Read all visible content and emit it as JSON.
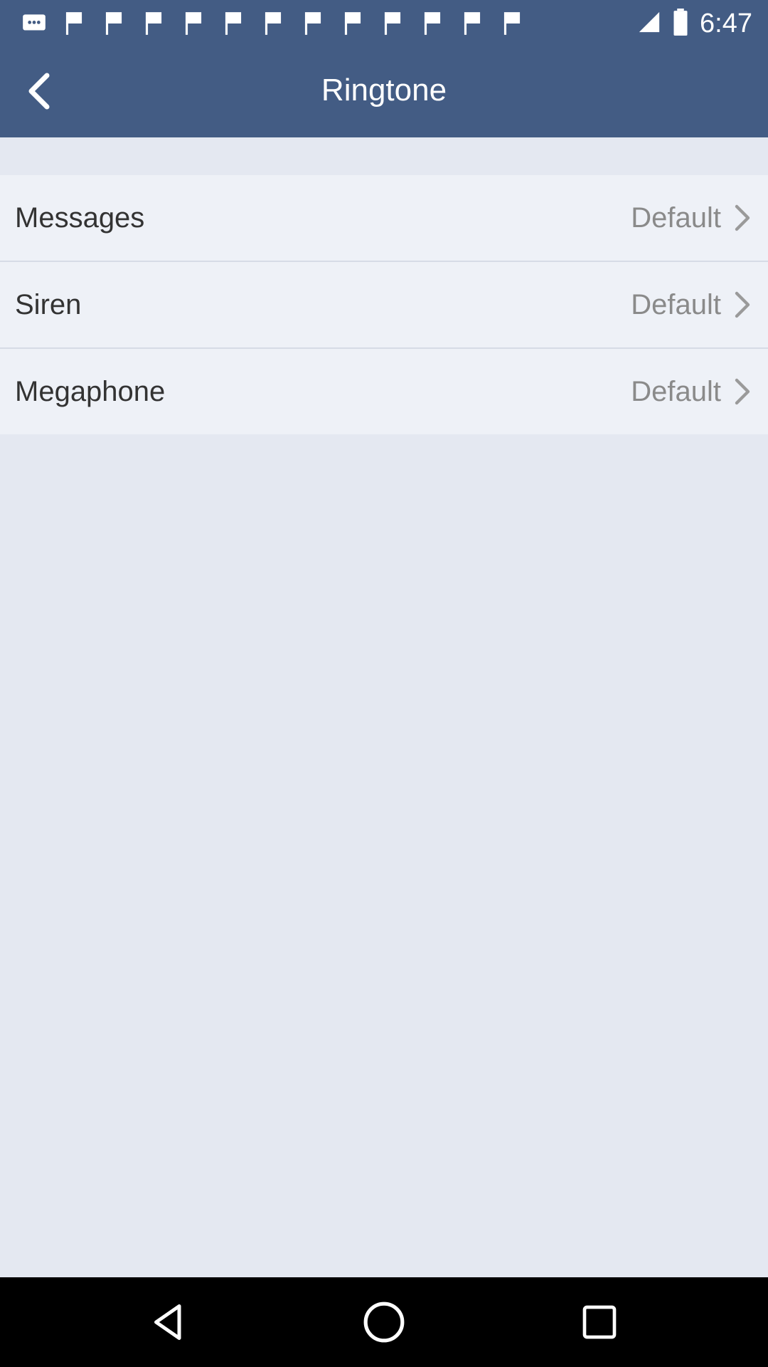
{
  "status_bar": {
    "time": "6:47",
    "notification_icons": [
      "chat-icon",
      "flag-icon",
      "flag-icon",
      "flag-icon",
      "flag-icon",
      "flag-icon",
      "flag-icon",
      "flag-icon",
      "flag-icon",
      "flag-icon",
      "flag-icon",
      "flag-icon",
      "flag-icon"
    ],
    "right_icons": [
      "signal-icon",
      "battery-icon"
    ]
  },
  "app_bar": {
    "title": "Ringtone",
    "back_icon": "chevron-left-icon",
    "background_color": "#435c84"
  },
  "settings": [
    {
      "label": "Messages",
      "value": "Default"
    },
    {
      "label": "Siren",
      "value": "Default"
    },
    {
      "label": "Megaphone",
      "value": "Default"
    }
  ],
  "nav_bar": {
    "buttons": [
      "back-triangle-icon",
      "home-circle-icon",
      "recents-square-icon"
    ]
  }
}
